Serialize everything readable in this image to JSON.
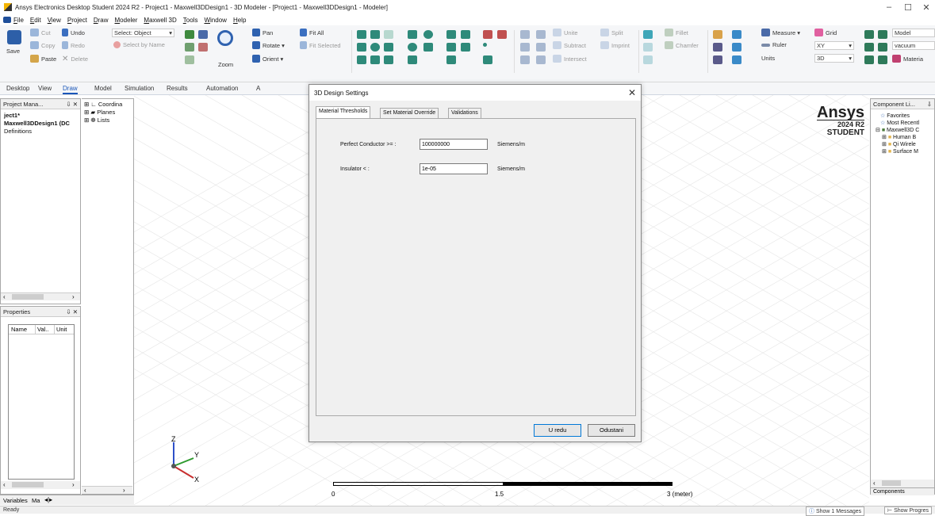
{
  "window": {
    "title": "Ansys Electronics Desktop Student 2024 R2 - Project1 - Maxwell3DDesign1 - 3D Modeler - [Project1 - Maxwell3DDesign1 - Modeler]",
    "minimize": "–",
    "maximize": "☐",
    "close": "✕"
  },
  "menu": [
    "File",
    "Edit",
    "View",
    "Project",
    "Draw",
    "Modeler",
    "Maxwell 3D",
    "Tools",
    "Window",
    "Help"
  ],
  "ribbon": {
    "save": "Save",
    "cut": "Cut",
    "copy": "Copy",
    "paste": "Paste",
    "undo": "Undo",
    "redo": "Redo",
    "delete": "Delete",
    "select_object": "Select: Object",
    "select_by_name": "Select by Name",
    "zoom": "Zoom",
    "pan": "Pan",
    "rotate": "Rotate",
    "orient": "Orient",
    "fit_all": "Fit All",
    "fit_selected": "Fit Selected",
    "unite": "Unite",
    "subtract": "Subtract",
    "intersect": "Intersect",
    "split": "Split",
    "imprint": "Imprint",
    "fillet": "Fillet",
    "chamfer": "Chamfer",
    "measure": "Measure",
    "ruler": "Ruler",
    "units": "Units",
    "grid": "Grid",
    "plane_value": "XY",
    "mode_value": "3D",
    "model_value": "Model",
    "vacuum_value": "vacuum",
    "material": "Materia"
  },
  "tabs": [
    "Desktop",
    "View",
    "Draw",
    "Model",
    "Simulation",
    "Results",
    "Automation",
    "A"
  ],
  "active_tab": "Draw",
  "project_manager": {
    "header": "Project Mana...",
    "pin": "⇩ ✕",
    "items": [
      "ject1*",
      "Maxwell3DDesign1 (DC",
      "Definitions"
    ]
  },
  "model_tree": {
    "items": [
      "Coordina",
      "Planes",
      "Lists"
    ]
  },
  "properties": {
    "header": "Properties",
    "pin": "⇩ ✕",
    "columns": [
      "Name",
      "Val..",
      "Unit"
    ]
  },
  "bottom_left_tabs": [
    "Variables",
    "Ma"
  ],
  "component_library": {
    "header": "Component Li...",
    "pin": "⇩",
    "items": [
      "Favorites",
      "Most Recentl",
      "Maxwell3D C",
      "Human B",
      "Qi Wirele",
      "Surface M"
    ],
    "bottom_tab": "Components"
  },
  "logo": {
    "name": "Ansys",
    "version": "2024 R2",
    "edition": "STUDENT"
  },
  "scale_bar": {
    "labels": [
      "0",
      "1.5",
      "3 (meter)"
    ]
  },
  "dialog": {
    "title": "3D Design Settings",
    "close": "✕",
    "tabs": [
      "Material Thresholds",
      "Set Material Override",
      "Validations"
    ],
    "active_tab": "Material Thresholds",
    "fields": [
      {
        "label": "Perfect Conductor >= :",
        "value": "100000000",
        "unit": "Siemens/m"
      },
      {
        "label": "Insulator < :",
        "value": "1e-05",
        "unit": "Siemens/m"
      }
    ],
    "ok": "U redu",
    "cancel": "Odustani"
  },
  "status": {
    "text": "Ready",
    "messages": "Show 1 Messages",
    "progress": "Show Progres"
  }
}
